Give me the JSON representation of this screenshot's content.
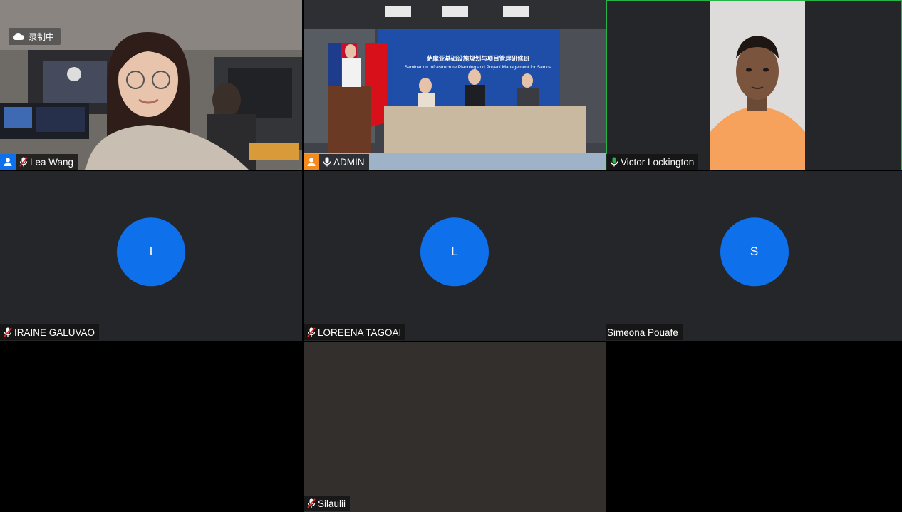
{
  "recording": {
    "label": "录制中",
    "icon": "cloud-icon"
  },
  "participants": [
    {
      "name": "Lea Wang",
      "kind": "video",
      "muted": true,
      "badge": "person-icon",
      "badge_color": "#0e71eb"
    },
    {
      "name": "ADMIN",
      "kind": "video",
      "muted": false,
      "badge": "person-icon",
      "badge_color": "#f58b1f"
    },
    {
      "name": "Victor Lockington",
      "kind": "video",
      "muted": false,
      "active_speaker": true
    },
    {
      "name": "IRAINE GALUVAO",
      "initial": "I",
      "kind": "avatar",
      "muted": true
    },
    {
      "name": "LOREENA TAGOAI",
      "initial": "L",
      "kind": "avatar",
      "muted": true
    },
    {
      "name": "Simeona Pouafe",
      "initial": "S",
      "kind": "avatar",
      "muted": false,
      "no_mic_icon": true
    },
    {
      "name": "Silaulii",
      "kind": "blank",
      "muted": true
    }
  ],
  "stage_banner": {
    "title_cn": "萨摩亚基础设施规划与项目管理研修班",
    "title_en": "Seminar on Infrastructure Planning and Project Management for Samoa"
  },
  "colors": {
    "accent": "#0e71eb",
    "active_border": "#26b34a",
    "tile_bg": "#25262a",
    "banner_blue": "#1f4ea8"
  }
}
